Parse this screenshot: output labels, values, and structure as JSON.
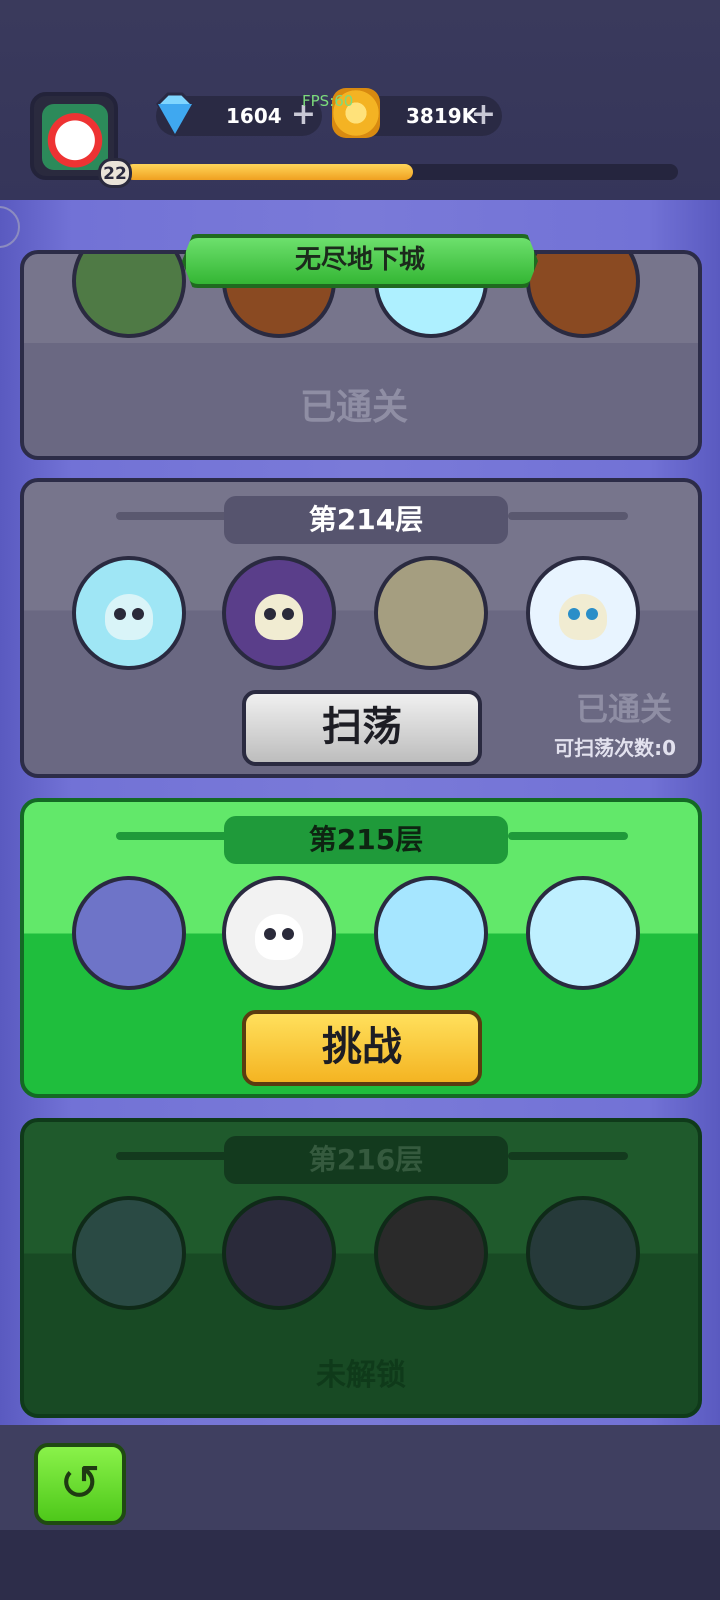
{
  "header": {
    "level": "22",
    "xp_progress": 0.52,
    "gems": "1604",
    "coins": "3819K",
    "fps_overlay": "FPS:60"
  },
  "title": "无尽地下城",
  "floors": [
    {
      "label": "",
      "status": "已通关",
      "monsters": [
        "goblin-icon",
        "pumpkin-icon",
        "ice-golem-icon",
        "pumpkin-icon"
      ]
    },
    {
      "label": "第214层",
      "status": "已通关",
      "sweep_button": "扫荡",
      "sweep_count": "可扫荡次数:0",
      "monsters": [
        "ice-skeleton-icon",
        "reaper-skull-icon",
        "stone-golem-icon",
        "snow-skull-icon"
      ]
    },
    {
      "label": "第215层",
      "challenge_button": "挑战",
      "monsters": [
        "ice-fly-icon",
        "ghost-icon",
        "ice-golem-icon",
        "snow-yeti-icon"
      ]
    },
    {
      "label": "第216层",
      "status": "未解锁",
      "monsters": [
        "ice-skeleton-icon",
        "reaper-skull-icon",
        "skull-icon",
        "dark-bucket-icon"
      ]
    }
  ],
  "colors": {
    "accent_green": "#34b634",
    "challenge_yellow": "#f4b422",
    "xp_fill": "#f0a020"
  }
}
